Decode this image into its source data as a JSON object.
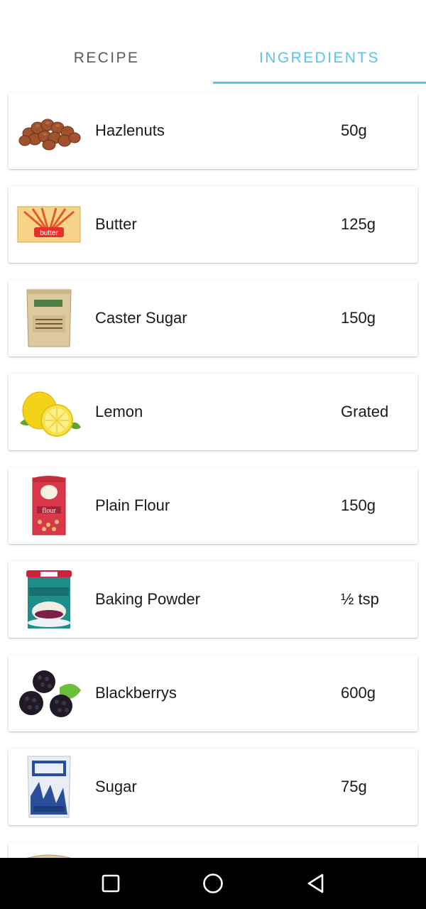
{
  "tabs": [
    {
      "label": "RECIPE",
      "active": false
    },
    {
      "label": "INGREDIENTS",
      "active": true
    }
  ],
  "colors": {
    "accent": "#5bc3e9",
    "inactive_tab": "#5b5b5b",
    "navbar": "#000000"
  },
  "ingredients": [
    {
      "name": "Hazlenuts",
      "amount": "50g",
      "icon": "hazelnuts-image"
    },
    {
      "name": "Butter",
      "amount": "125g",
      "icon": "butter-image"
    },
    {
      "name": "Caster Sugar",
      "amount": "150g",
      "icon": "caster-sugar-bag-image"
    },
    {
      "name": "Lemon",
      "amount": "Grated",
      "icon": "lemon-image"
    },
    {
      "name": "Plain Flour",
      "amount": "150g",
      "icon": "flour-bag-image"
    },
    {
      "name": "Baking Powder",
      "amount": "½ tsp",
      "icon": "baking-powder-tub-image"
    },
    {
      "name": "Blackberrys",
      "amount": "600g",
      "icon": "blackberries-image"
    },
    {
      "name": "Sugar",
      "amount": "75g",
      "icon": "sugar-bag-image"
    }
  ],
  "navbar": {
    "icons": [
      "recents-square-icon",
      "home-circle-icon",
      "back-triangle-icon"
    ]
  }
}
